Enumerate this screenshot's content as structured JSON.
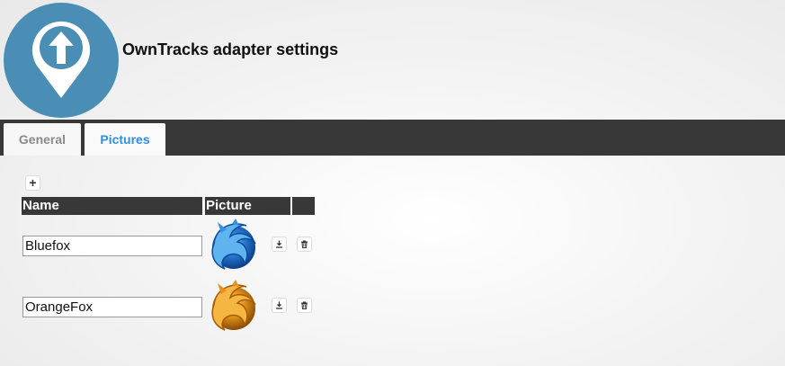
{
  "header": {
    "title": "OwnTracks adapter settings",
    "logo_icon": "owntracks-logo-icon",
    "logo_color": "#4a8db5"
  },
  "tabs": [
    {
      "label": "General",
      "active": false
    },
    {
      "label": "Pictures",
      "active": true
    }
  ],
  "pictures_table": {
    "add_icon_label": "+",
    "columns": [
      "Name",
      "Picture",
      ""
    ],
    "rows": [
      {
        "name": "Bluefox",
        "picture_icon": "bluefox-icon",
        "picture_color": "#2a7fd4"
      },
      {
        "name": "OrangeFox",
        "picture_icon": "orangefox-icon",
        "picture_color": "#e89a1c"
      }
    ],
    "row_actions": [
      "upload-icon",
      "delete-icon"
    ]
  },
  "colors": {
    "tabbar": "#383838",
    "active_tab_text": "#2f8ee0",
    "inactive_tab_text": "#8a8a8a",
    "header_cell": "#383838"
  }
}
